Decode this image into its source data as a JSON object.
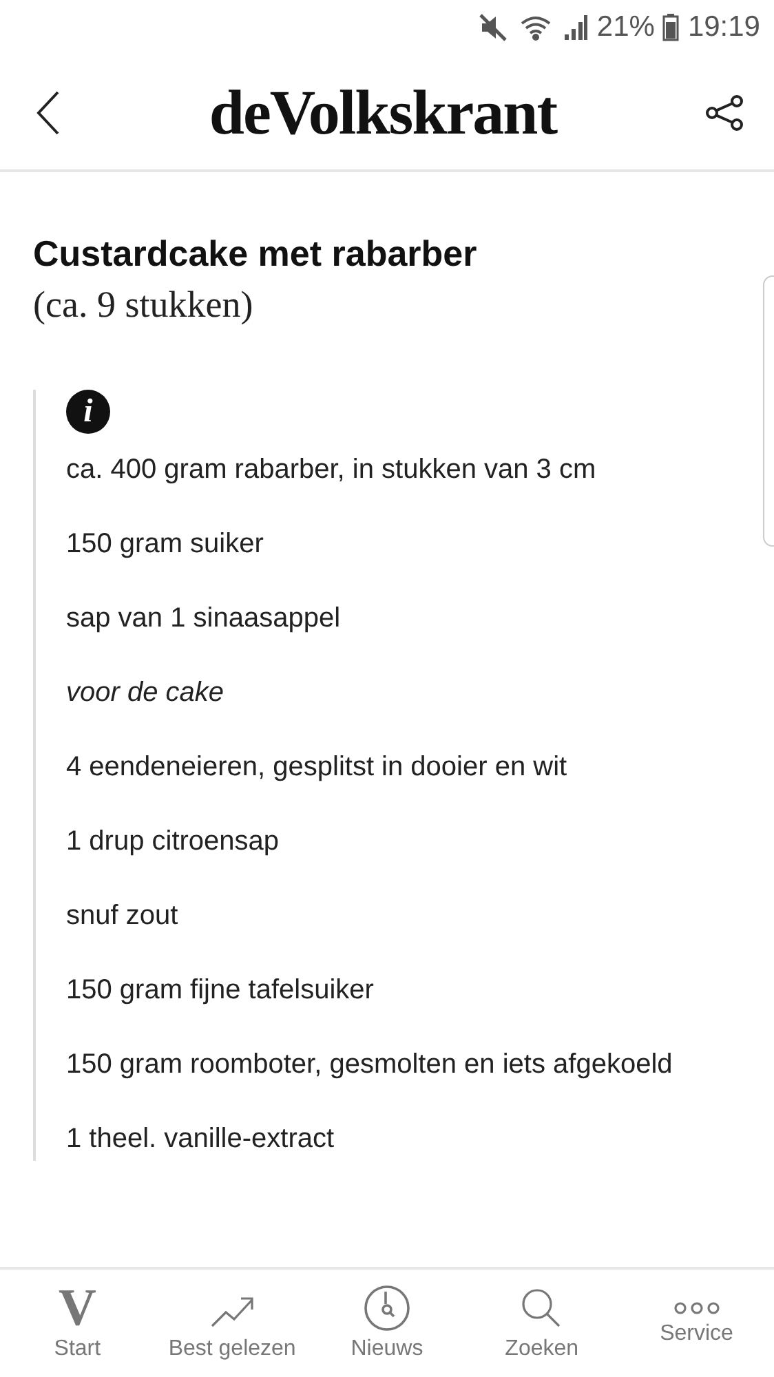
{
  "status_bar": {
    "battery": "21%",
    "time": "19:19"
  },
  "header": {
    "logo": "deVolkskrant"
  },
  "article": {
    "title": "Custardcake met rabarber",
    "subtitle": "(ca. 9 stukken)",
    "info_icon": "i",
    "ingredients": [
      {
        "kind": "item",
        "text": "ca. 400 gram rabarber, in stukken van 3 cm"
      },
      {
        "kind": "item",
        "text": "150 gram suiker"
      },
      {
        "kind": "item",
        "text": "sap van 1 sinaasappel"
      },
      {
        "kind": "heading",
        "text": "voor de cake"
      },
      {
        "kind": "item",
        "text": "4 eendeneieren, gesplitst in dooier en wit"
      },
      {
        "kind": "item",
        "text": "1 drup citroensap"
      },
      {
        "kind": "item",
        "text": "snuf zout"
      },
      {
        "kind": "item",
        "text": "150 gram fijne tafelsuiker"
      },
      {
        "kind": "item",
        "text": "150 gram roomboter, gesmolten en iets afgekoeld"
      },
      {
        "kind": "item",
        "text": "1 theel. vanille-extract"
      }
    ]
  },
  "bottom_nav": [
    {
      "kind": "logo",
      "icon_letter": "V",
      "label": "Start"
    },
    {
      "kind": "trending",
      "label": "Best gelezen"
    },
    {
      "kind": "clock",
      "label": "Nieuws"
    },
    {
      "kind": "search",
      "label": "Zoeken"
    },
    {
      "kind": "more",
      "label": "Service"
    }
  ]
}
